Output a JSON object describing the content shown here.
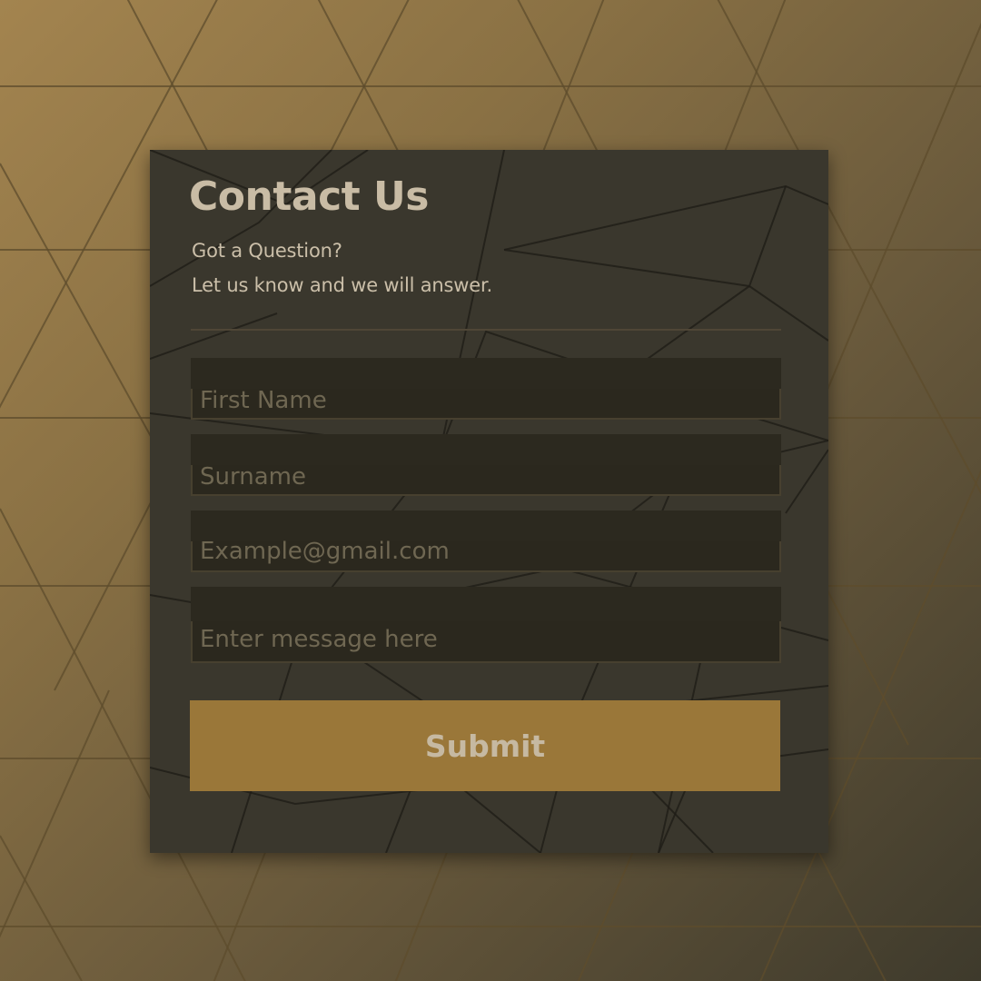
{
  "form": {
    "title": "Contact Us",
    "subtitle_line1": "Got a Question?",
    "subtitle_line2": "Let us know and we will answer.",
    "fields": [
      {
        "placeholder": "First Name"
      },
      {
        "placeholder": "Surname"
      },
      {
        "placeholder": "Example@gmail.com"
      },
      {
        "placeholder": "Enter message here"
      }
    ],
    "submit_label": "Submit"
  },
  "colors": {
    "background": "#8a7144",
    "card": "#3a372d",
    "accent": "#9a7739",
    "text": "#c9bca5",
    "placeholder": "#6f6752"
  }
}
